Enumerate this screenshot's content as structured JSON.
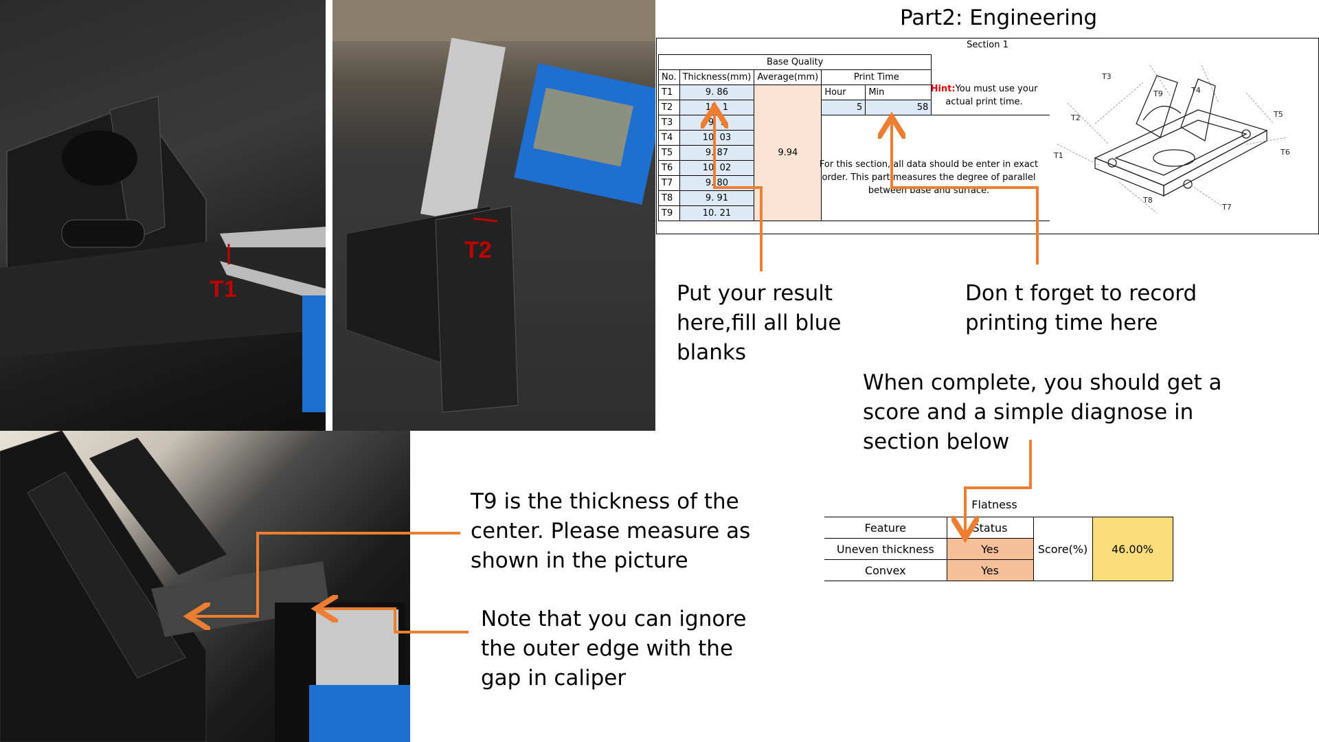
{
  "slide": {
    "title": "Part2: Engineering"
  },
  "photos": {
    "t1_label": "T1",
    "t2_label": "T2"
  },
  "section1": {
    "title": "Section 1",
    "base_quality_header": "Base Quality",
    "col_no": "No.",
    "col_thickness": "Thickness(mm)",
    "col_average": "Average(mm)",
    "print_time_header": "Print Time",
    "hour_label": "Hour",
    "min_label": "Min",
    "hour_value": "5",
    "min_value": "58",
    "average_value": "9.94",
    "rows": [
      {
        "no": "T1",
        "thickness": "9. 86"
      },
      {
        "no": "T2",
        "thickness": "10. 1"
      },
      {
        "no": "T3",
        "thickness": "9. 7"
      },
      {
        "no": "T4",
        "thickness": "10. 03"
      },
      {
        "no": "T5",
        "thickness": "9. 87"
      },
      {
        "no": "T6",
        "thickness": "10. 02"
      },
      {
        "no": "T7",
        "thickness": "9. 80"
      },
      {
        "no": "T8",
        "thickness": "9. 91"
      },
      {
        "no": "T9",
        "thickness": "10. 21"
      }
    ],
    "hint_label": "Hint:",
    "hint_text": "You must use your actual print time.",
    "note": "For this section, all data should be enter in exact order. This part measures the degree of parallel between base and surface."
  },
  "drawing_labels": [
    "T3",
    "T9",
    "T4",
    "T2",
    "T5",
    "T1",
    "T6",
    "T8",
    "T7"
  ],
  "annotations": {
    "result": "Put your result here,fill all blue blanks",
    "time": "Don t forget to record printing time here",
    "complete": "When complete, you should get a score and a simple diagnose in section below",
    "t9": "T9 is the thickness of the center. Please measure as shown in the picture",
    "note": "Note that you can ignore the outer edge with the gap in caliper"
  },
  "flatness": {
    "title": "Flatness",
    "col_feature": "Feature",
    "col_status": "Status",
    "rows": [
      {
        "feature": "Uneven thickness",
        "status": "Yes"
      },
      {
        "feature": "Convex",
        "status": "Yes"
      }
    ],
    "score_label": "Score(%)",
    "score_value": "46.00%"
  },
  "colors": {
    "arrow": "#ed7d31",
    "blue_cell": "#dde9f5",
    "peach_cell": "#fbe4d4",
    "status_cell": "#f6c099",
    "score_cell": "#fbdd7a",
    "label_red": "#c00000"
  }
}
